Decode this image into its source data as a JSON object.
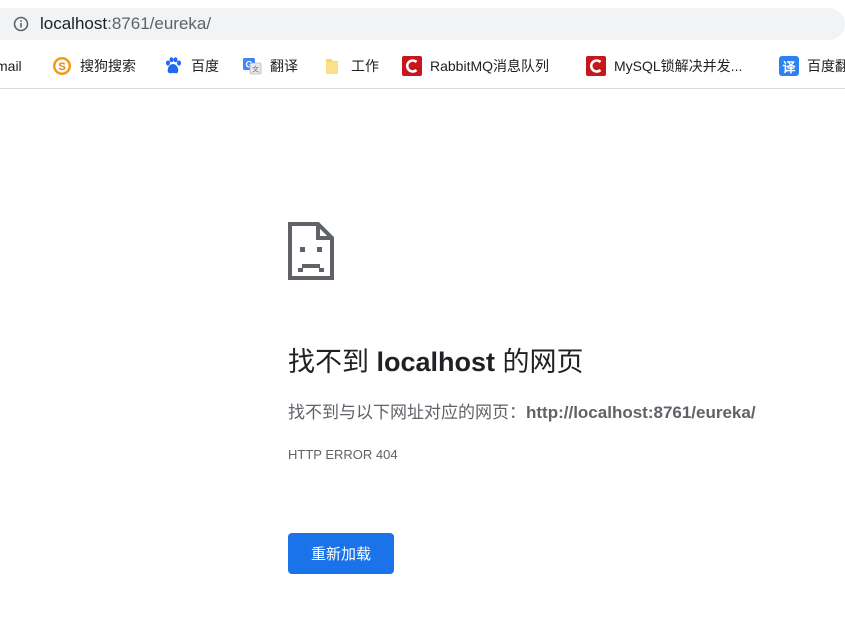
{
  "address_bar": {
    "host": "localhost",
    "path": ":8761/eureka/",
    "info_icon": "info-icon"
  },
  "bookmarks": [
    {
      "label": "mail",
      "icon": "gmail-icon"
    },
    {
      "label": "搜狗搜索",
      "icon": "sogou-icon"
    },
    {
      "label": "百度",
      "icon": "baidu-paw-icon"
    },
    {
      "label": "翻译",
      "icon": "google-translate-icon"
    },
    {
      "label": "工作",
      "icon": "folder-icon"
    },
    {
      "label": "RabbitMQ消息队列",
      "icon": "csdn-icon"
    },
    {
      "label": "MySQL锁解决并发...",
      "icon": "csdn-icon"
    },
    {
      "label": "百度翻",
      "icon": "translate-icon",
      "icon_text": "译"
    }
  ],
  "error_page": {
    "title_prefix": "找不到 ",
    "title_host": "localhost",
    "title_suffix": " 的网页",
    "description_prefix": "找不到与以下网址对应的网页：",
    "description_url": "http://localhost:8761/eureka/",
    "error_code": "HTTP ERROR 404",
    "reload_label": "重新加载",
    "icon": "sad-page-icon"
  },
  "colors": {
    "accent": "#1a73e8",
    "text_primary": "#202124",
    "text_secondary": "#5f6368",
    "csdn_red": "#c8161d",
    "folder_yellow": "#fdd663"
  }
}
